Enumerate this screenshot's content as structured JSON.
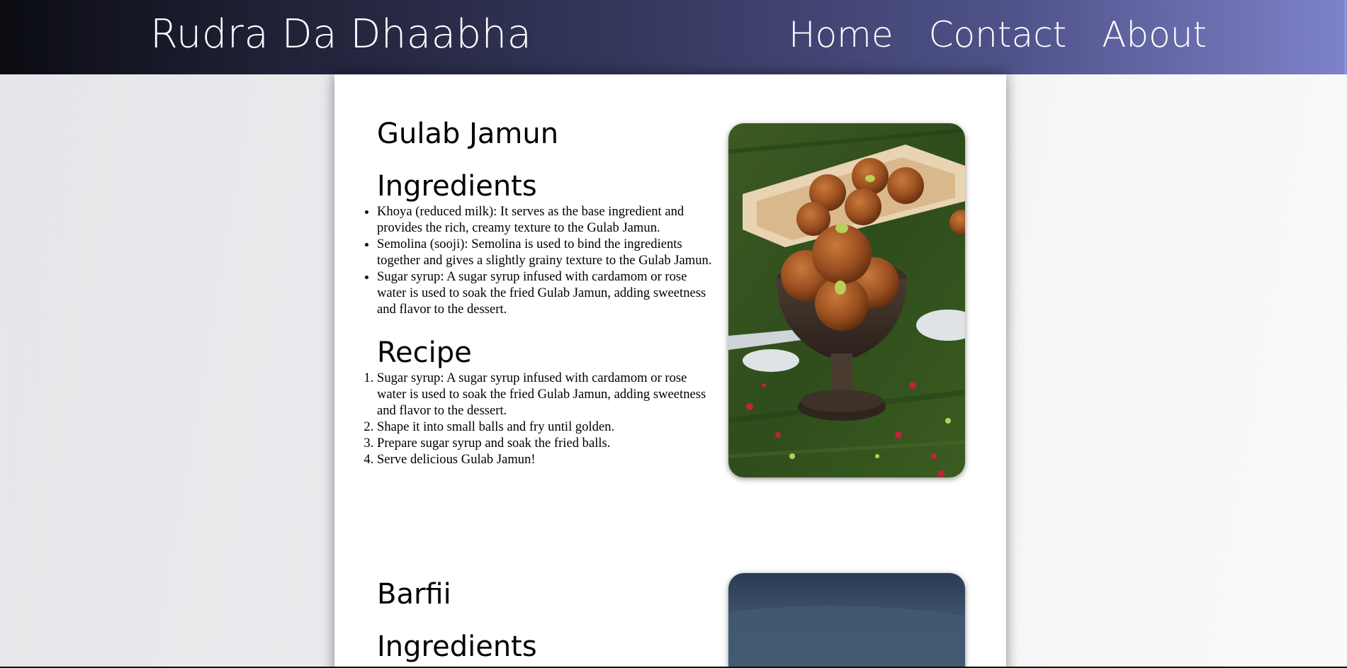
{
  "navbar": {
    "brand": "Rudra Da Dhaabha",
    "links": [
      {
        "label": "Home"
      },
      {
        "label": "Contact"
      },
      {
        "label": "About"
      }
    ]
  },
  "dishes": [
    {
      "title": "Gulab Jamun",
      "ingredients_heading": "Ingredients",
      "ingredients": [
        "Khoya (reduced milk): It serves as the base ingredient and provides the rich, creamy texture to the Gulab Jamun.",
        "Semolina (sooji): Semolina is used to bind the ingredients together and gives a slightly grainy texture to the Gulab Jamun.",
        "Sugar syrup: A sugar syrup infused with cardamom or rose water is used to soak the fried Gulab Jamun, adding sweetness and flavor to the dessert."
      ],
      "recipe_heading": "Recipe",
      "recipe": [
        "Sugar syrup: A sugar syrup infused with cardamom or rose water is used to soak the fried Gulab Jamun, adding sweetness and flavor to the dessert.",
        "Shape it into small balls and fry until golden.",
        "Prepare sugar syrup and soak the fried balls.",
        "Serve delicious Gulab Jamun!"
      ]
    },
    {
      "title": "Barfii",
      "ingredients_heading": "Ingredients"
    }
  ]
}
